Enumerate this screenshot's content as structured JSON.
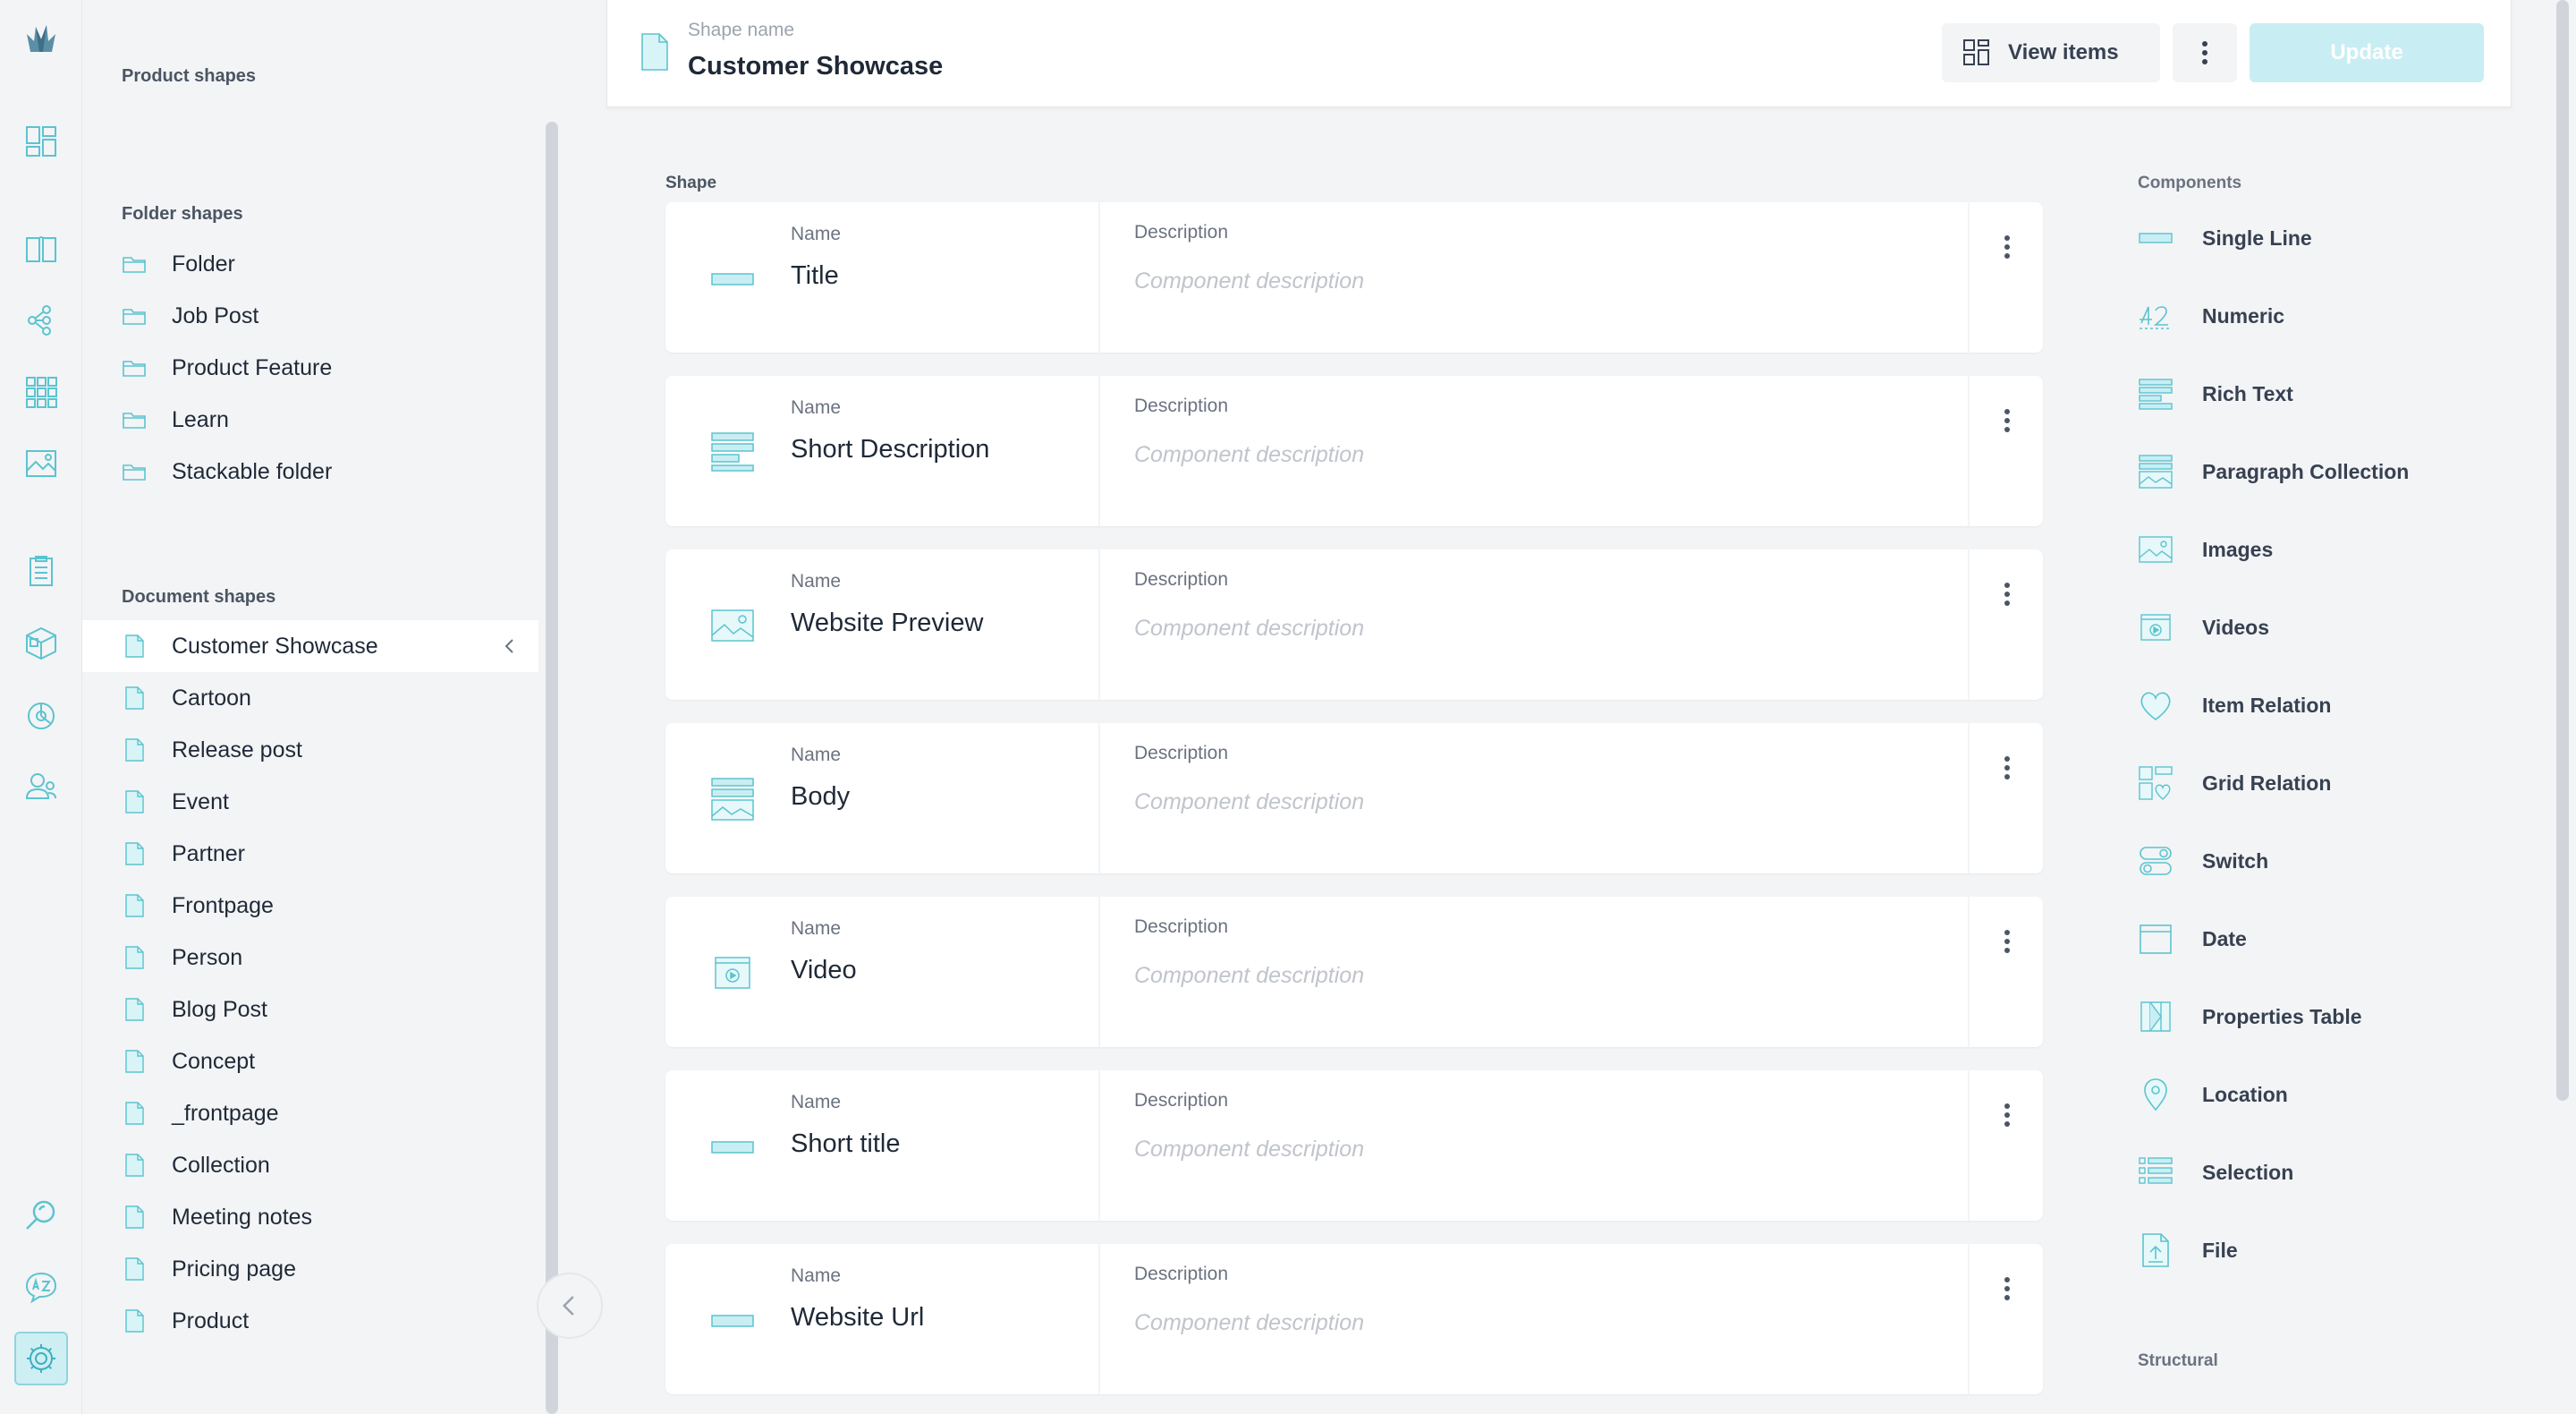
{
  "colors": {
    "accent": "#5bc4cf",
    "accent_light": "#c8eef3",
    "bg": "#f3f4f6"
  },
  "sidebar": {
    "product_title": "Product shapes",
    "folder_title": "Folder shapes",
    "folders": [
      "Folder",
      "Job Post",
      "Product Feature",
      "Learn",
      "Stackable folder"
    ],
    "document_title": "Document shapes",
    "documents": [
      "Customer Showcase",
      "Cartoon",
      "Release post",
      "Event",
      "Partner",
      "Frontpage",
      "Person",
      "Blog Post",
      "Concept",
      "_frontpage",
      "Collection",
      "Meeting notes",
      "Pricing page",
      "Product"
    ]
  },
  "header": {
    "shape_name_label": "Shape name",
    "shape_name": "Customer Showcase",
    "view_items": "View items",
    "update": "Update"
  },
  "shape": {
    "title": "Shape",
    "name_label": "Name",
    "description_label": "Description",
    "description_placeholder": "Component description",
    "components": [
      {
        "name": "Title",
        "icon": "single-line-icon"
      },
      {
        "name": "Short Description",
        "icon": "rich-text-icon"
      },
      {
        "name": "Website Preview",
        "icon": "images-icon"
      },
      {
        "name": "Body",
        "icon": "paragraph-collection-icon"
      },
      {
        "name": "Video",
        "icon": "videos-icon"
      },
      {
        "name": "Short title",
        "icon": "single-line-icon"
      },
      {
        "name": "Website Url",
        "icon": "single-line-icon"
      }
    ]
  },
  "palette": {
    "title": "Components",
    "items": [
      "Single Line",
      "Numeric",
      "Rich Text",
      "Paragraph Collection",
      "Images",
      "Videos",
      "Item Relation",
      "Grid Relation",
      "Switch",
      "Date",
      "Properties Table",
      "Location",
      "Selection",
      "File"
    ],
    "structural_title": "Structural"
  }
}
